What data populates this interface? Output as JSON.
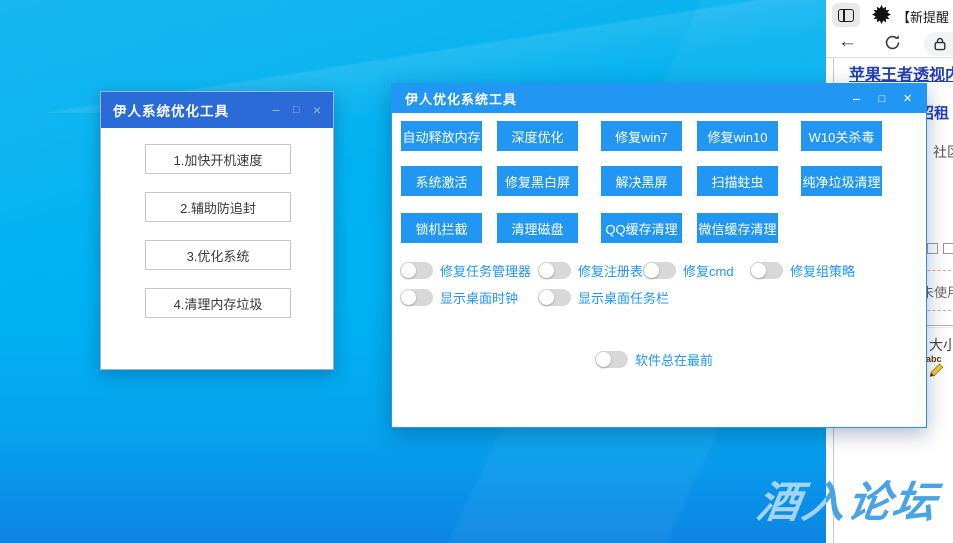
{
  "colors": {
    "accent_blue": "#2196f3",
    "mini_titlebar_blue": "#2b6bd8",
    "link_blue": "#2440b3",
    "toggle_label_blue": "#2196f3",
    "watermark_blue": "#49a3e7",
    "desktop_cyan": "#00b2f2"
  },
  "desktop": {
    "watermark_text": "酒入论坛"
  },
  "mini_window": {
    "title": "伊人系统优化工具",
    "minimize_glyph": "−",
    "maximize_glyph": "□",
    "close_glyph": "×",
    "buttons": [
      "1.加快开机速度",
      "2.辅助防追封",
      "3.优化系统",
      "4.清理内存垃圾"
    ]
  },
  "main_window": {
    "title": "伊人优化系统工具",
    "minimize_glyph": "−",
    "maximize_glyph": "□",
    "close_glyph": "×",
    "buttons_row1": [
      "自动释放内存",
      "深度优化",
      "修复win7",
      "修复win10",
      "W10关杀毒"
    ],
    "buttons_row2": [
      "系统激活",
      "修复黑白屏",
      "解决黑屏",
      "扫描蛀虫",
      "纯净垃圾清理"
    ],
    "buttons_row3": [
      "锁机拦截",
      "清理磁盘",
      "QQ缓存清理",
      "微信缓存清理"
    ],
    "toggles_row1": [
      "修复任务管理器",
      "修复注册表",
      "修复cmd",
      "修复组策略"
    ],
    "toggles_row2": [
      "显示桌面时钟",
      "显示桌面任务栏"
    ],
    "toggle_front": "软件总在最前"
  },
  "browser": {
    "tab_title": "【新提醒",
    "back_glyph": "←",
    "page": {
      "link_top": "苹果王者透视内",
      "link_rent": "招租",
      "text_community": "社区",
      "text_unused": "未使用",
      "text_size": "大小"
    }
  }
}
